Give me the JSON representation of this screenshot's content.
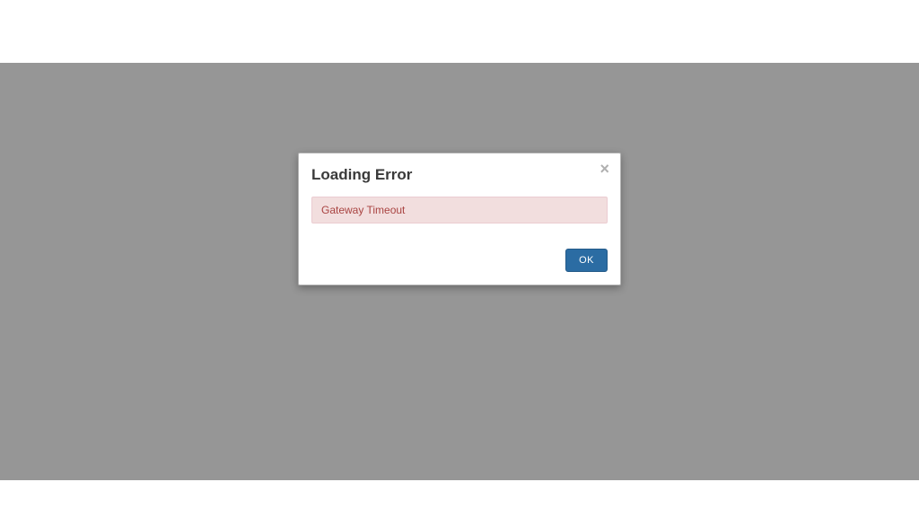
{
  "modal": {
    "title": "Loading Error",
    "message": "Gateway Timeout",
    "close_icon": "×",
    "ok_label": "OK"
  }
}
